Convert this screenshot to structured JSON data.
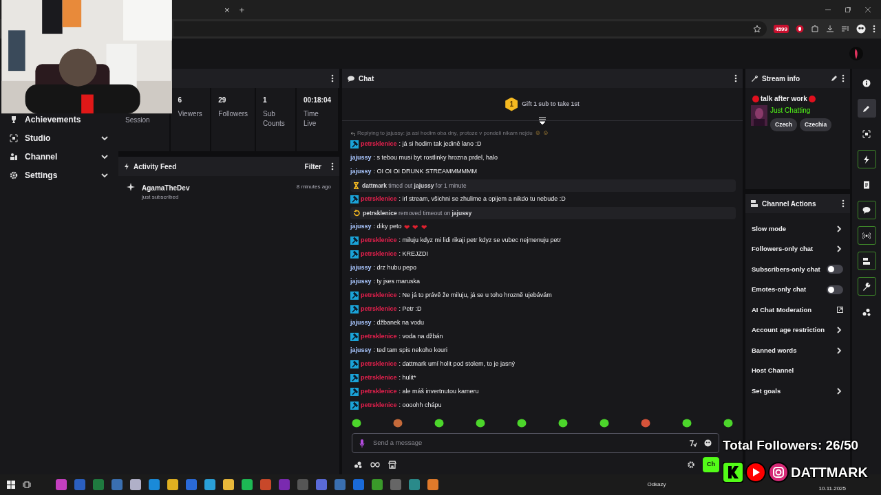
{
  "browser": {
    "tab_close": "×",
    "new_tab": "+",
    "extension_badge": "4599"
  },
  "sidebar": {
    "items": [
      {
        "label": "Achievements",
        "kind": "trophy",
        "expandable": false
      },
      {
        "label": "Studio",
        "kind": "studio",
        "expandable": true
      },
      {
        "label": "Channel",
        "kind": "channel",
        "expandable": true
      },
      {
        "label": "Settings",
        "kind": "settings",
        "expandable": true
      }
    ]
  },
  "stats": {
    "items": [
      {
        "label": "Session"
      },
      {
        "value": "6",
        "label": "Viewers"
      },
      {
        "value": "29",
        "label": "Followers"
      },
      {
        "value": "1",
        "label": "Sub Counts"
      },
      {
        "value": "00:18:04",
        "label": "Time Live"
      }
    ]
  },
  "activity_feed": {
    "title": "Activity Feed",
    "filter": "Filter",
    "events": [
      {
        "user": "AgamaTheDev",
        "action": "just subscribed",
        "time": "8 minutes ago"
      }
    ]
  },
  "chat": {
    "title": "Chat",
    "leaderboard": {
      "rank": "1",
      "text": "Gift 1 sub to take 1st"
    },
    "messages": [
      {
        "kind": "message",
        "user": "petrsklenice",
        "color": "#e8204e",
        "moderator": true,
        "text": ": já si hodim tak jedině lano :D",
        "reply": {
          "text": "Replying to jajussy: ja asi hodim oba dny, protoze v pondeli nikam nejdu",
          "emotes": "☺ ☺"
        }
      },
      {
        "kind": "message",
        "user": "jajussy",
        "color": "#a9c6ff",
        "moderator": false,
        "text": ": s tebou musi byt rostlinky hrozna prdel, halo"
      },
      {
        "kind": "message",
        "user": "jajussy",
        "color": "#a9c6ff",
        "moderator": false,
        "text": ": OI OI OI DRUNK STREAMMMMMM"
      },
      {
        "kind": "timeout",
        "text": "**dattmark** timed out **jajussy** for 1 minute"
      },
      {
        "kind": "message",
        "user": "petrsklenice",
        "color": "#e8204e",
        "moderator": true,
        "text": ": irl stream, všichni se zhulime a opijem a nikdo tu nebude :D"
      },
      {
        "kind": "untimeout",
        "text": "**petrsklenice** removed timeout on **jajussy**"
      },
      {
        "kind": "message",
        "user": "jajussy",
        "color": "#a9c6ff",
        "moderator": false,
        "text": ": diky peto",
        "emotes": "❤ ❤ ❤"
      },
      {
        "kind": "message",
        "user": "petrsklenice",
        "color": "#e8204e",
        "moderator": true,
        "text": ": miluju kdyz mi lidi rikaji petr kdyz se vubec nejmenuju petr"
      },
      {
        "kind": "message",
        "user": "petrsklenice",
        "color": "#e8204e",
        "moderator": true,
        "text": ": KREJZDI"
      },
      {
        "kind": "message",
        "user": "jajussy",
        "color": "#a9c6ff",
        "moderator": false,
        "text": ": drz hubu pepo"
      },
      {
        "kind": "message",
        "user": "jajussy",
        "color": "#a9c6ff",
        "moderator": false,
        "text": ": ty jses maruska"
      },
      {
        "kind": "message",
        "user": "petrsklenice",
        "color": "#e8204e",
        "moderator": true,
        "text": ": Ne já to právě že miluju, já se u toho hrozně ujebávám"
      },
      {
        "kind": "message",
        "user": "petrsklenice",
        "color": "#e8204e",
        "moderator": true,
        "text": ": Petr :D"
      },
      {
        "kind": "message",
        "user": "jajussy",
        "color": "#a9c6ff",
        "moderator": false,
        "text": ": džbanek na vodu"
      },
      {
        "kind": "message",
        "user": "petrsklenice",
        "color": "#e8204e",
        "moderator": true,
        "text": ": voda na džbán"
      },
      {
        "kind": "message",
        "user": "jajussy",
        "color": "#a9c6ff",
        "moderator": false,
        "text": ": ted tam spis nekoho kouri"
      },
      {
        "kind": "message",
        "user": "petrsklenice",
        "color": "#e8204e",
        "moderator": true,
        "text": ": dattmark umí holit pod stolem, to je jasný"
      },
      {
        "kind": "message",
        "user": "petrsklenice",
        "color": "#e8204e",
        "moderator": true,
        "text": ": hulit*"
      },
      {
        "kind": "message",
        "user": "petrsklenice",
        "color": "#e8204e",
        "moderator": true,
        "text": ": ale máš invertnutou kameru"
      },
      {
        "kind": "message",
        "user": "petrsklenice",
        "color": "#e8204e",
        "moderator": true,
        "text": ": oooohh chápu"
      }
    ],
    "input": {
      "placeholder": "Send a message"
    },
    "send_button": "Ch"
  },
  "stream_info": {
    "title": "Stream info",
    "stream_title": "talk after work",
    "category": "Just Chatting",
    "tags": [
      "Czech",
      "Czechia"
    ]
  },
  "channel_actions": {
    "title": "Channel Actions",
    "items": [
      {
        "label": "Slow mode",
        "kind": "submenu"
      },
      {
        "label": "Followers-only chat",
        "kind": "submenu"
      },
      {
        "label": "Subscribers-only chat",
        "kind": "toggle",
        "on": false
      },
      {
        "label": "Emotes-only chat",
        "kind": "toggle",
        "on": false
      },
      {
        "label": "AI Chat Moderation",
        "kind": "external"
      },
      {
        "label": "Account age restriction",
        "kind": "submenu"
      },
      {
        "label": "Banned words",
        "kind": "submenu"
      },
      {
        "label": "Host Channel",
        "kind": "plain"
      },
      {
        "label": "Set goals",
        "kind": "submenu"
      }
    ]
  },
  "rail": {
    "items": [
      {
        "kind": "info",
        "selected": false,
        "pinned": false
      },
      {
        "kind": "pencil",
        "selected": true,
        "pinned": false
      },
      {
        "kind": "focus",
        "selected": false,
        "pinned": false
      },
      {
        "kind": "bolt",
        "selected": false,
        "pinned": true
      },
      {
        "kind": "document",
        "selected": false,
        "pinned": false
      },
      {
        "kind": "chat",
        "selected": false,
        "pinned": true
      },
      {
        "kind": "broadcast",
        "selected": false,
        "pinned": true
      },
      {
        "kind": "actions",
        "selected": false,
        "pinned": true
      },
      {
        "kind": "wrench",
        "selected": false,
        "pinned": true
      },
      {
        "kind": "dots",
        "selected": false,
        "pinned": false
      }
    ]
  },
  "overlay": {
    "followers": "Total Followers: 26/50",
    "brand": "DATTMARK"
  },
  "taskbar": {
    "links": "Odkazy",
    "date": "10.11.2025"
  }
}
